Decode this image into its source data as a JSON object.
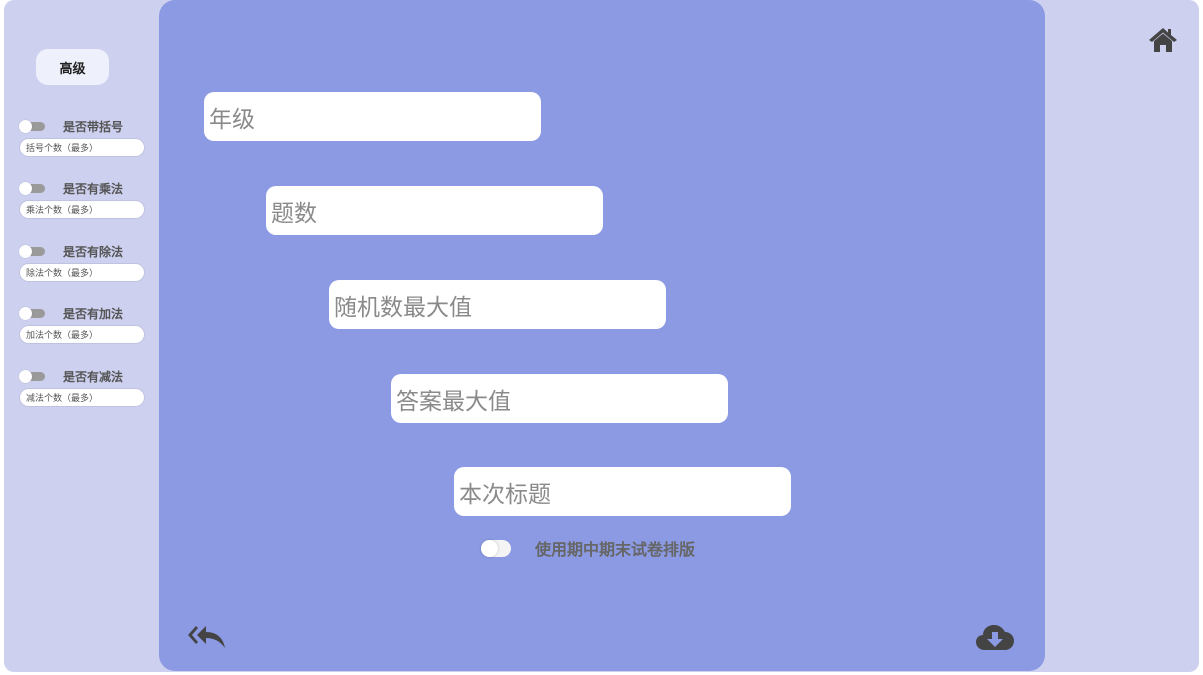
{
  "sidebar": {
    "advanced_label": "高级",
    "options": [
      {
        "label": "是否带括号",
        "placeholder": "括号个数（最多）"
      },
      {
        "label": "是否有乘法",
        "placeholder": "乘法个数（最多）"
      },
      {
        "label": "是否有除法",
        "placeholder": "除法个数（最多）"
      },
      {
        "label": "是否有加法",
        "placeholder": "加法个数（最多）"
      },
      {
        "label": "是否有减法",
        "placeholder": "减法个数（最多）"
      }
    ]
  },
  "form": {
    "fields": [
      {
        "placeholder": "年级"
      },
      {
        "placeholder": "题数"
      },
      {
        "placeholder": "随机数最大值"
      },
      {
        "placeholder": "答案最大值"
      },
      {
        "placeholder": "本次标题"
      }
    ],
    "exam_layout_label": "使用期中期末试卷排版"
  },
  "icons": {
    "home": "home-icon",
    "back": "reply-all-icon",
    "download": "cloud-download-icon"
  },
  "colors": {
    "background": "#cdd0ef",
    "panel": "#8b9ae3",
    "icon": "#444444"
  }
}
